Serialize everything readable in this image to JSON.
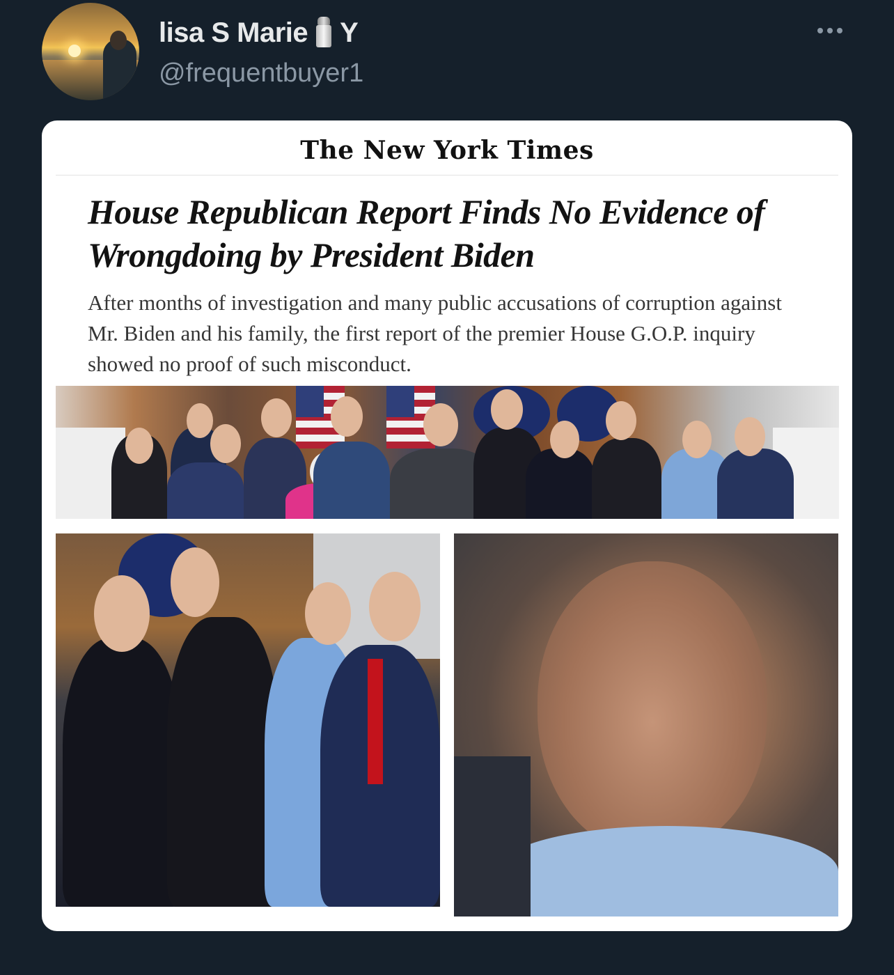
{
  "tweet": {
    "display_name": "lisa S Marie",
    "name_suffix": "Y",
    "handle": "@frequentbuyer1"
  },
  "article": {
    "masthead": "The New York Times",
    "headline": "House Republican Report Finds No Evidence of Wrongdoing by President Biden",
    "summary": "After months of investigation and many public accusations of corruption against Mr. Biden and his family, the first report of the premier House G.O.P. inquiry showed no proof of such misconduct."
  },
  "icons": {
    "name_emoji": "salt-shaker-icon",
    "more": "more-icon"
  },
  "colors": {
    "background": "#15202b",
    "name": "#e7e9ea",
    "handle": "#8b98a5",
    "card": "#ffffff"
  }
}
